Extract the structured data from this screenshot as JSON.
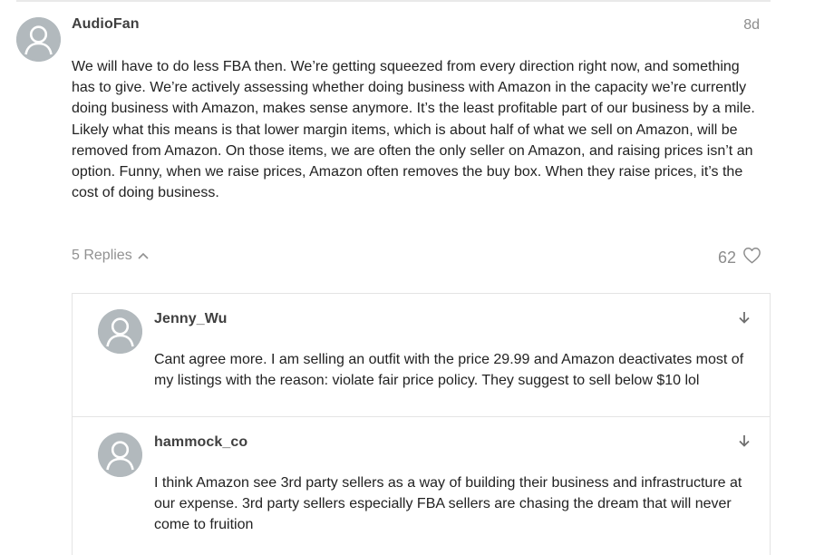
{
  "post": {
    "username": "AudioFan",
    "date": "8d",
    "avatar_icon": "user-avatar-icon",
    "body": "We will have to do less FBA then. We’re getting squeezed from every direction right now, and something has to give. We’re actively assessing whether doing business with Amazon in the capacity we’re currently doing business with Amazon, makes sense anymore. It’s the least profitable part of our business by a mile. Likely what this means is that lower margin items, which is about half of what we sell on Amazon, will be removed from Amazon. On those items, we are often the only seller on Amazon, and raising prices isn’t an option. Funny, when we raise prices, Amazon often removes the buy box. When they raise prices, it’s the cost of doing business.",
    "replies_label": "5 Replies",
    "replies_icon": "chevron-up-icon",
    "likes_count": "62",
    "likes_icon": "heart-outline-icon"
  },
  "replies": [
    {
      "username": "Jenny_Wu",
      "body": "Cant agree more. I am selling an outfit with the price 29.99 and Amazon deactivates most of my listings with the reason: violate fair price policy. They suggest to sell below $10 lol",
      "arrow_icon": "arrow-down-icon"
    },
    {
      "username": "hammock_co",
      "body": "I think Amazon see 3rd party sellers as a way of building their business and infrastructure at our expense. 3rd party sellers especially FBA sellers are chasing the dream that will never come to fruition",
      "arrow_icon": "arrow-down-icon"
    }
  ],
  "colors": {
    "avatar_bg": "#b2b9bd",
    "muted_text": "#8d8d8d",
    "border": "#e4e4e4"
  }
}
